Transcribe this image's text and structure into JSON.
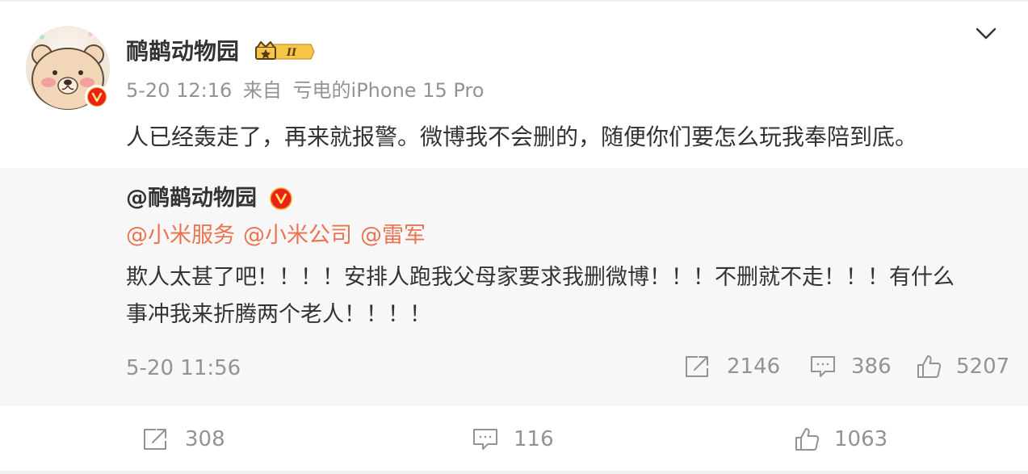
{
  "post": {
    "author": "鸸鹋动物园",
    "time": "5-20 12:16",
    "source_prefix": "来自",
    "source": "亏电的iPhone 15 Pro",
    "text": "人已经轰走了，再来就报警。微博我不会删的，随便你们要怎么玩我奉陪到底。",
    "member_level": "II",
    "stats": {
      "reposts": "308",
      "comments": "116",
      "likes": "1063"
    }
  },
  "repost": {
    "author": "@鸸鹋动物园",
    "mentions": [
      "@小米服务",
      "@小米公司",
      "@雷军"
    ],
    "body_lines": [
      "欺人太甚了吧！！！！安排人跑我父母家要求我删微博！！！不删就不走！！！有什么",
      "事冲我来折腾两个老人！！！！"
    ],
    "time": "5-20 11:56",
    "stats": {
      "reposts": "2146",
      "comments": "386",
      "likes": "5207"
    }
  },
  "icons": {
    "verified": "verified-v-icon",
    "more": "chevron-down-icon",
    "repost": "share-icon",
    "comment": "comment-icon",
    "like": "thumbs-up-icon"
  },
  "colors": {
    "mention": "#eb7350",
    "verified": "#e8221b",
    "muted": "#939393",
    "repost_bg": "#f7f7f7"
  }
}
